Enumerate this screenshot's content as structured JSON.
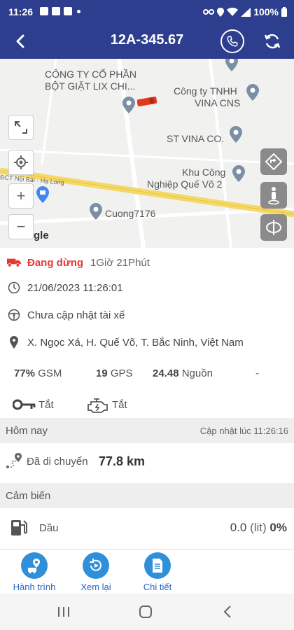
{
  "status_bar": {
    "time": "11:26",
    "battery": "100%"
  },
  "header": {
    "title": "12A-345.67"
  },
  "map": {
    "pois": {
      "lix_line1": "CÔNG TY CỔ PHẦN",
      "lix_line2": "BỘT GIẶT LIX CHI...",
      "tnhh_line1": "Công ty TNHH",
      "tnhh_line2": "VINA CNS",
      "stvina": "ST VINA CO.",
      "kcn_line1": "Khu Công",
      "kcn_line2": "Nghiệp Quế Võ 2",
      "cuong": "Cuong7176",
      "road": "ĐCT Nội Bài - Hạ Long"
    },
    "zoom_in": "+",
    "zoom_out": "−",
    "google_fragment": "gle"
  },
  "vehicle": {
    "status": "Đang dừng",
    "duration": "1Giờ 21Phút",
    "timestamp": "21/06/2023 11:26:01",
    "driver": "Chưa cập nhật tài xế",
    "address": "X. Ngọc Xá, H. Quế Võ, T. Bắc Ninh, Việt Nam"
  },
  "stats": {
    "gsm_value": "77%",
    "gsm_label": "GSM",
    "gps_value": "19",
    "gps_label": "GPS",
    "power_value": "24.48",
    "power_label": "Nguồn",
    "extra": "-"
  },
  "toggles": {
    "key_label": "Tắt",
    "engine_label": "Tắt"
  },
  "today": {
    "header": "Hôm nay",
    "updated": "Cập nhật lúc 11:26:16",
    "distance_label": "Đã di chuyển",
    "distance_value": "77.8 km"
  },
  "sensors": {
    "header": "Cảm biến",
    "fuel_label": "Dầu",
    "fuel_value": "0.0",
    "fuel_unit": "(lit)",
    "fuel_percent": "0%"
  },
  "bottom_nav": {
    "trip": "Hành trình",
    "replay": "Xem lại",
    "details": "Chi tiết"
  },
  "colors": {
    "primary": "#2d3e8e",
    "accent": "#2f8fd8",
    "stopped": "#e53935"
  }
}
